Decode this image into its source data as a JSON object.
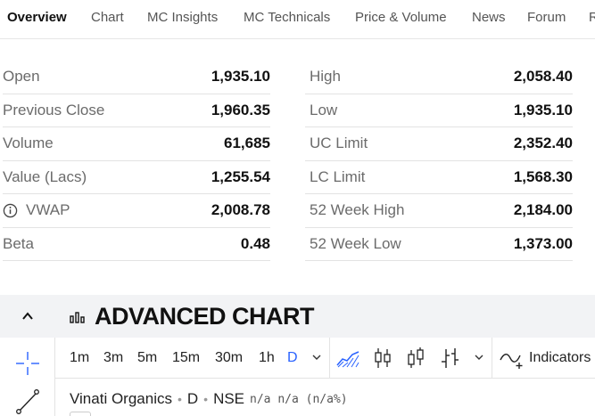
{
  "tabs": [
    {
      "label": "Overview",
      "active": true
    },
    {
      "label": "Chart",
      "active": false
    },
    {
      "label": "MC Insights",
      "active": false
    },
    {
      "label": "MC Technicals",
      "active": false
    },
    {
      "label": "Price & Volume",
      "active": false
    },
    {
      "label": "News",
      "active": false
    },
    {
      "label": "Forum",
      "active": false
    },
    {
      "label": "R",
      "active": false
    }
  ],
  "stats": {
    "left": [
      {
        "label": "Open",
        "value": "1,935.10"
      },
      {
        "label": "Previous Close",
        "value": "1,960.35"
      },
      {
        "label": "Volume",
        "value": "61,685"
      },
      {
        "label": "Value (Lacs)",
        "value": "1,255.54"
      },
      {
        "label": "VWAP",
        "value": "2,008.78",
        "icon": "info-icon"
      },
      {
        "label": "Beta",
        "value": "0.48"
      }
    ],
    "right": [
      {
        "label": "High",
        "value": "2,058.40"
      },
      {
        "label": "Low",
        "value": "1,935.10"
      },
      {
        "label": "UC Limit",
        "value": "2,352.40"
      },
      {
        "label": "LC Limit",
        "value": "1,568.30"
      },
      {
        "label": "52 Week High",
        "value": "2,184.00"
      },
      {
        "label": "52 Week Low",
        "value": "1,373.00"
      }
    ]
  },
  "chart": {
    "title": "ADVANCED CHART",
    "timeframes": [
      "1m",
      "3m",
      "5m",
      "15m",
      "30m",
      "1h",
      "D"
    ],
    "active_timeframe": "D",
    "indicators_label": "Indicators",
    "legend": {
      "symbol": "Vinati Organics",
      "interval": "D",
      "exchange": "NSE",
      "values": "n/a n/a (n/a%)"
    },
    "accent_color": "#2962ff"
  },
  "icons": [
    "info-icon",
    "chevron-up-icon",
    "bar-chart-icon",
    "crosshair-icon",
    "trend-line-icon",
    "chevron-down-icon",
    "area-chart-icon",
    "candlestick-icon",
    "hollow-candle-icon",
    "ohlc-bars-icon",
    "indicators-icon"
  ]
}
